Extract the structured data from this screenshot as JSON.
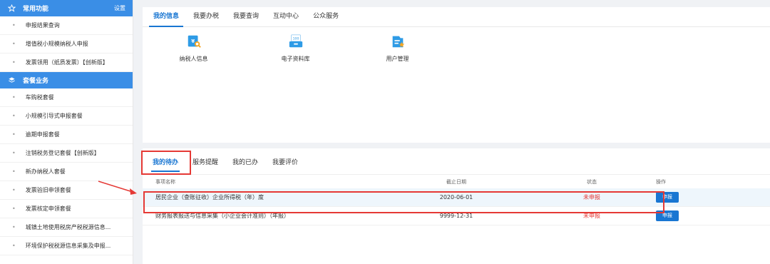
{
  "sidebar": {
    "common": {
      "title": "常用功能",
      "settings": "设置"
    },
    "common_items": [
      "申报结果查询",
      "增值税小规模纳税人申报",
      "发票领用（纸质发票）【创新版】"
    ],
    "package": {
      "title": "套餐业务"
    },
    "package_items": [
      "车购税套餐",
      "小规模引导式申报套餐",
      "逾期申报套餐",
      "注销税务登记套餐【创新版】",
      "新办纳税人套餐",
      "发票验旧申领套餐",
      "发票核定申领套餐",
      "城镇土地使用税房产税税源信息...",
      "环境保护税税源信息采集及申报..."
    ]
  },
  "top_tabs": [
    "我的信息",
    "我要办税",
    "我要查询",
    "互动中心",
    "公众服务"
  ],
  "info_icons": [
    {
      "label": "纳税人信息",
      "icon": "taxpayer-info-icon"
    },
    {
      "label": "电子资料库",
      "icon": "e-library-icon"
    },
    {
      "label": "用户管理",
      "icon": "user-management-icon"
    }
  ],
  "bottom_tabs": [
    "我的待办",
    "服务提醒",
    "我的已办",
    "我要评价"
  ],
  "table": {
    "headers": [
      "事项名称",
      "截止日期",
      "状态",
      "操作"
    ],
    "rows": [
      {
        "name": "居民企业（查账征收）企业所得税（年）度",
        "date": "2020-06-01",
        "status": "未申报",
        "action": "申报"
      },
      {
        "name": "财务报表报送与信息采集（小企业会计准则）（年报）",
        "date": "9999-12-31",
        "status": "未申报",
        "action": "申报"
      }
    ]
  },
  "colors": {
    "accent": "#1976d2",
    "highlight": "#e53935",
    "sidebar_header": "#3a8ee6"
  }
}
